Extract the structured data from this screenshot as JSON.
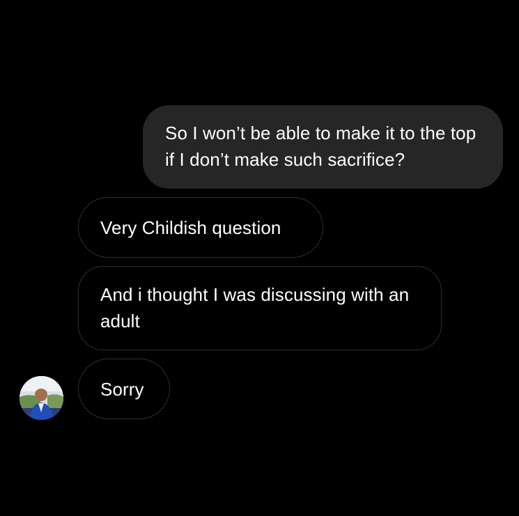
{
  "conversation": {
    "messages": [
      {
        "sender": "me",
        "text": "So I won’t be able to make it to the top if I don’t make such sacrifice?"
      },
      {
        "sender": "other",
        "text": "Very Childish question"
      },
      {
        "sender": "other",
        "text": "And i thought I was discussing with an adult"
      },
      {
        "sender": "other",
        "text": "Sorry"
      }
    ]
  },
  "colors": {
    "background": "#000000",
    "sent_bubble": "#262626",
    "received_border": "#2e2e2e",
    "text": "#ffffff"
  },
  "icons": {
    "avatar": "contact-avatar-photo"
  }
}
